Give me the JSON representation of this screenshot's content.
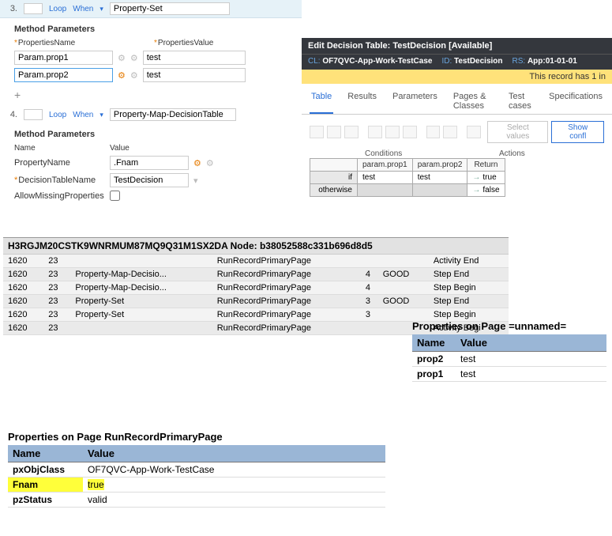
{
  "step3": {
    "num": "3.",
    "loop": "Loop",
    "when": "When",
    "method": "Property-Set",
    "title": "Method Parameters",
    "hdr_name": "PropertiesName",
    "hdr_value": "PropertiesValue",
    "rows": [
      {
        "name": "Param.prop1",
        "value": "test"
      },
      {
        "name": "Param.prop2",
        "value": "test"
      }
    ]
  },
  "step4": {
    "num": "4.",
    "loop": "Loop",
    "when": "When",
    "method": "Property-Map-DecisionTable",
    "title": "Method Parameters",
    "hdr_name": "Name",
    "hdr_value": "Value",
    "rows": [
      {
        "name": "PropertyName",
        "value": ".Fnam",
        "req": false
      },
      {
        "name": "DecisionTableName",
        "value": "TestDecision",
        "req": true
      },
      {
        "name": "AllowMissingProperties",
        "value": "",
        "req": false,
        "checkbox": true
      }
    ]
  },
  "dt": {
    "header": "Edit Decision Table: TestDecision [Available]",
    "cl_lbl": "CL:",
    "cl_val": "OF7QVC-App-Work-TestCase",
    "id_lbl": "ID:",
    "id_val": "TestDecision",
    "rs_lbl": "RS:",
    "rs_val": "App:01-01-01",
    "warn": "This record has 1 in",
    "tabs": [
      "Table",
      "Results",
      "Parameters",
      "Pages & Classes",
      "Test cases",
      "Specifications"
    ],
    "btn_select": "Select values",
    "btn_conf": "Show confl",
    "cond_lbl": "Conditions",
    "act_lbl": "Actions",
    "cols": [
      "param.prop1",
      "param.prop2",
      "Return"
    ],
    "rows": [
      {
        "lbl": "if",
        "c1": "test",
        "c2": "test",
        "ret": "true"
      },
      {
        "lbl": "otherwise",
        "c1": "",
        "c2": "",
        "ret": "false"
      }
    ]
  },
  "tracer": {
    "title": "H3RGJM20CSTK9WNRMUM87MQ9Q31M1SX2DA Node: b38052588c331b696d8d5",
    "rows": [
      {
        "a": "1620",
        "b": "23",
        "c": "",
        "d": "RunRecordPrimaryPage",
        "e": "",
        "f": "",
        "g": "Activity End"
      },
      {
        "a": "1620",
        "b": "23",
        "c": "Property-Map-Decisio...",
        "d": "RunRecordPrimaryPage",
        "e": "4",
        "f": "GOOD",
        "g": "Step End"
      },
      {
        "a": "1620",
        "b": "23",
        "c": "Property-Map-Decisio...",
        "d": "RunRecordPrimaryPage",
        "e": "4",
        "f": "",
        "g": "Step Begin"
      },
      {
        "a": "1620",
        "b": "23",
        "c": "Property-Set",
        "d": "RunRecordPrimaryPage",
        "e": "3",
        "f": "GOOD",
        "g": "Step End"
      },
      {
        "a": "1620",
        "b": "23",
        "c": "Property-Set",
        "d": "RunRecordPrimaryPage",
        "e": "3",
        "f": "",
        "g": "Step Begin"
      },
      {
        "a": "1620",
        "b": "23",
        "c": "",
        "d": "RunRecordPrimaryPage",
        "e": "",
        "f": "",
        "g": "Activity Begi"
      }
    ]
  },
  "props_unnamed": {
    "title": "Properties on Page =unnamed=",
    "hdr_name": "Name",
    "hdr_value": "Value",
    "rows": [
      {
        "name": "prop2",
        "value": "test"
      },
      {
        "name": "prop1",
        "value": "test"
      }
    ]
  },
  "props_run": {
    "title": "Properties on Page RunRecordPrimaryPage",
    "hdr_name": "Name",
    "hdr_value": "Value",
    "rows": [
      {
        "name": "pxObjClass",
        "value": "OF7QVC-App-Work-TestCase",
        "hl": false
      },
      {
        "name": "Fnam",
        "value": "true",
        "hl": true
      },
      {
        "name": "pzStatus",
        "value": "valid",
        "hl": false
      }
    ]
  }
}
